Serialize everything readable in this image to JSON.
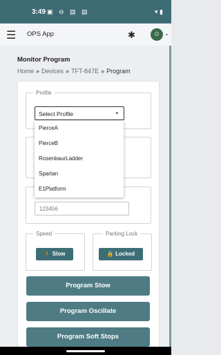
{
  "status": {
    "time": "3:49",
    "icons": "▣ ⊖ ▤ ▤",
    "right_icons": "▾ ▮"
  },
  "app": {
    "title": "OPS App",
    "menu_icon": "☰",
    "bluetooth_icon": "✱",
    "avatar": "☺",
    "caret": "⌄"
  },
  "page": {
    "heading": "Monitor Program",
    "breadcrumb": {
      "home": "Home",
      "devices": "Devices",
      "device": "TFT-847E",
      "current": "Program",
      "sep": "»"
    }
  },
  "profile": {
    "legend": "Profile",
    "select_value": "Select Profile",
    "select_arrow": "▾",
    "options": [
      "PierceA",
      "PierceB",
      "RosenbaurLadder",
      "Spartan",
      "E1Platform"
    ]
  },
  "code": {
    "value": "123456"
  },
  "speed": {
    "legend": "Speed",
    "button": "Slow",
    "icon": "🚶"
  },
  "parking": {
    "legend": "Parking Lock",
    "button": "Locked",
    "icon": "🔒"
  },
  "actions": [
    "Program Stow",
    "Program Oscillate",
    "Program Soft Stops"
  ]
}
